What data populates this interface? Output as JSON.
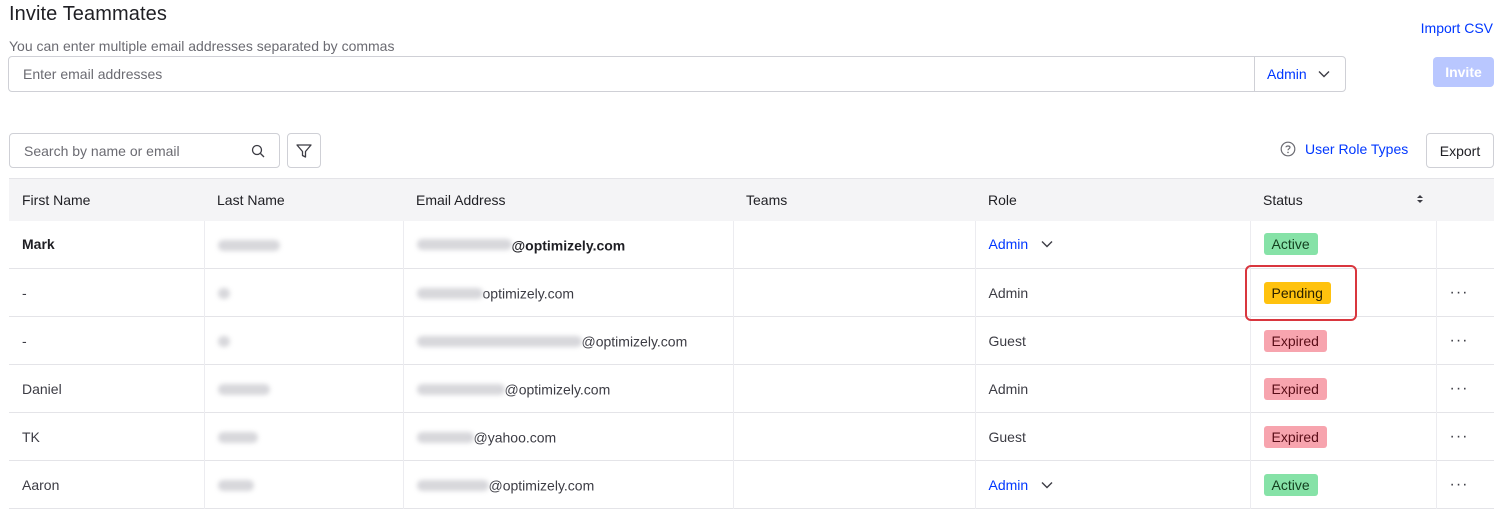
{
  "header": {
    "title": "Invite Teammates",
    "hint": "You can enter multiple email addresses separated by commas",
    "import_csv": "Import CSV"
  },
  "invite": {
    "email_placeholder": "Enter email addresses",
    "role_selected": "Admin",
    "invite_label": "Invite"
  },
  "toolbar": {
    "search_placeholder": "Search by name or email",
    "user_role_types": "User Role Types",
    "export_label": "Export"
  },
  "table": {
    "columns": [
      "First Name",
      "Last Name",
      "Email Address",
      "Teams",
      "Role",
      "Status"
    ],
    "rows": [
      {
        "first": "Mark",
        "email_domain": "@optimizely.com",
        "role": "Admin",
        "status": "Active"
      },
      {
        "first": "-",
        "email_domain": "optimizely.com",
        "role": "Admin",
        "status": "Pending"
      },
      {
        "first": "-",
        "email_domain": "@optimizely.com",
        "role": "Guest",
        "status": "Expired"
      },
      {
        "first": "Daniel",
        "email_domain": "@optimizely.com",
        "role": "Admin",
        "status": "Expired"
      },
      {
        "first": "TK",
        "email_domain": "@yahoo.com",
        "role": "Guest",
        "status": "Expired"
      },
      {
        "first": "Aaron",
        "email_domain": "@optimizely.com",
        "role": "Admin",
        "status": "Active"
      }
    ],
    "row_menu_label": "···"
  },
  "colors": {
    "accent": "#0037ff",
    "active": "#86e2a7",
    "pending": "#ffc20e",
    "expired": "#f7a4ae",
    "highlight": "#d9363e"
  },
  "icons": [
    "chevron-down-icon",
    "search-icon",
    "filter-icon",
    "help-circle-icon",
    "sort-icon",
    "more-dots-icon"
  ]
}
